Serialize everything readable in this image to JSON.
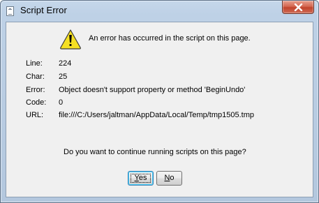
{
  "window": {
    "title": "Script Error",
    "close_icon": "close-icon"
  },
  "message": "An error has occurred in the script on this page.",
  "details": [
    {
      "label": "Line:",
      "value": "224"
    },
    {
      "label": "Char:",
      "value": "25"
    },
    {
      "label": "Error:",
      "value": "Object doesn't support property or method 'BeginUndo'"
    },
    {
      "label": "Code:",
      "value": "0"
    },
    {
      "label": "URL:",
      "value": "file:///C:/Users/jaltman/AppData/Local/Temp/tmp1505.tmp"
    }
  ],
  "question": "Do you want to continue running scripts on this page?",
  "buttons": {
    "yes": {
      "accel": "Y",
      "rest": "es"
    },
    "no": {
      "accel": "N",
      "rest": "o"
    }
  },
  "icons": {
    "title": "document-icon",
    "warning": "warning-icon"
  },
  "colors": {
    "warning_fill": "#f5e024",
    "close_button": "#c8452d"
  }
}
